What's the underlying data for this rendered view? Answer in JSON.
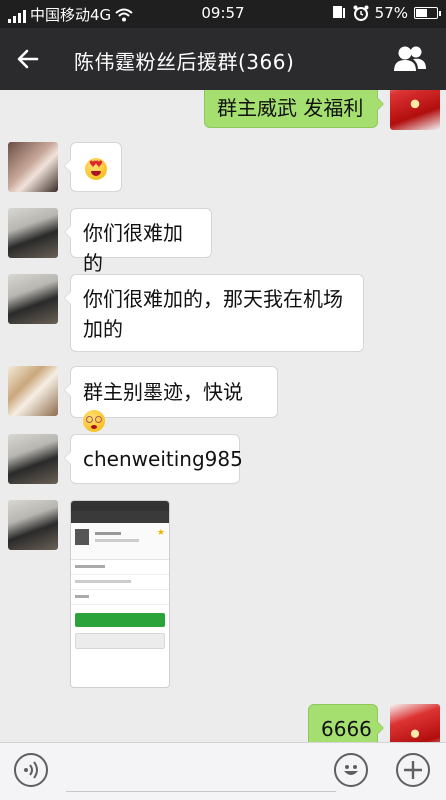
{
  "status_bar": {
    "carrier": "中国移动4G",
    "time": "09:57",
    "battery": "57%",
    "battery_level": 0.57
  },
  "header": {
    "title": "陈伟霆粉丝后援群(366)",
    "back_icon": "back-arrow-icon",
    "group_icon": "group-members-icon"
  },
  "messages": [
    {
      "sender": "me",
      "type": "text",
      "text": "群主威武 发福利"
    },
    {
      "sender": "member-1",
      "type": "emoji",
      "emoji": "heart-eyes"
    },
    {
      "sender": "member-2",
      "type": "text",
      "text": "你们很难加的"
    },
    {
      "sender": "member-2",
      "type": "text",
      "text_line1": "你们很难加的，那天我在机场",
      "text_line2": "加的"
    },
    {
      "sender": "member-3",
      "type": "text",
      "text": "群主别墨迹，快说",
      "emoji": "dizzy-face"
    },
    {
      "sender": "member-2",
      "type": "text",
      "text": "chenweiting985"
    },
    {
      "sender": "member-2",
      "type": "image",
      "description": "screenshot"
    },
    {
      "sender": "me",
      "type": "text",
      "text": "6666"
    }
  ],
  "input_bar": {
    "voice_icon": "voice-icon",
    "emoji_icon": "emoji-icon",
    "plus_icon": "plus-icon"
  },
  "colors": {
    "header_bg": "#2b2b2d",
    "chat_bg": "#ececec",
    "my_bubble": "#a5df6f",
    "their_bubble": "#ffffff"
  }
}
